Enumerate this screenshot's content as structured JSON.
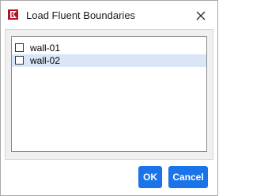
{
  "window": {
    "title": "Load Fluent Boundaries",
    "app_icon": "ansys-logo-icon",
    "close_icon": "close-icon"
  },
  "boundaries": {
    "items": [
      {
        "label": "wall-01",
        "checked": false,
        "highlighted": false
      },
      {
        "label": "wall-02",
        "checked": false,
        "highlighted": true
      }
    ]
  },
  "buttons": {
    "ok_label": "OK",
    "cancel_label": "Cancel"
  },
  "colors": {
    "accent": "#1a73e8",
    "row_highlight": "#d9e6f7",
    "icon_red": "#b0142a"
  }
}
